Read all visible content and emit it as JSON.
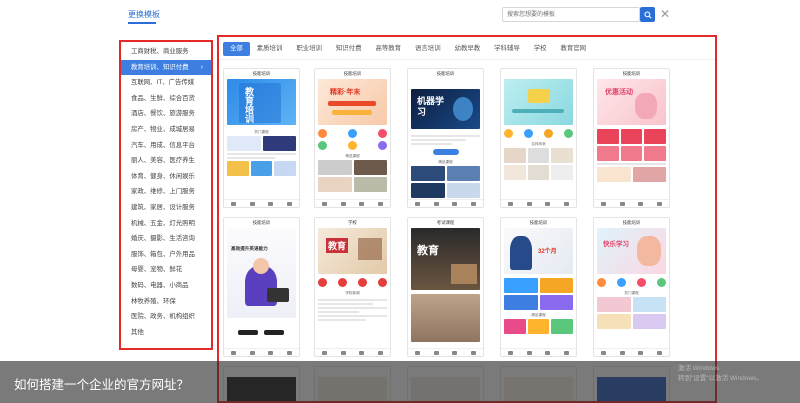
{
  "header": {
    "title": "更换模板",
    "search_placeholder": "搜索您想要的模板",
    "search_icon": "magnifier-icon",
    "close_icon": "close-x-icon",
    "accent_color": "#2b6fd6"
  },
  "sidebar": {
    "items": [
      {
        "label": "工商财税、商业服务"
      },
      {
        "label": "教育培训、知识付费",
        "active": true
      },
      {
        "label": "互联网、IT、广告传媒"
      },
      {
        "label": "食品、生鲜、综合百货"
      },
      {
        "label": "酒店、餐饮、旅游服务"
      },
      {
        "label": "房产、物业、成城居易"
      },
      {
        "label": "汽车、用成、信息平台"
      },
      {
        "label": "丽人、美容、医疗养生"
      },
      {
        "label": "体育、健身、休闲娱乐"
      },
      {
        "label": "家政、维修、上门服务"
      },
      {
        "label": "建筑、家居、设计服务"
      },
      {
        "label": "机械、五金、灯光照明"
      },
      {
        "label": "婚庆、摄影、生活咨询"
      },
      {
        "label": "服饰、箱包、户外用品"
      },
      {
        "label": "母婴、宠物、鲜花"
      },
      {
        "label": "数码、电器、小商品"
      },
      {
        "label": "林牧养殖、环保"
      },
      {
        "label": "医院、政务、机构组织"
      },
      {
        "label": "其他"
      }
    ]
  },
  "tabs": [
    {
      "label": "全部",
      "active": true
    },
    {
      "label": "素质培训"
    },
    {
      "label": "职业培训"
    },
    {
      "label": "知识付费"
    },
    {
      "label": "高等教育"
    },
    {
      "label": "语言培训"
    },
    {
      "label": "幼教早教"
    },
    {
      "label": "学科辅导"
    },
    {
      "label": "学校"
    },
    {
      "label": "教育官网"
    }
  ],
  "cards_row1": [
    {
      "head": "技能培训",
      "banner": "教育培训"
    },
    {
      "head": "技能培训",
      "banner": "精彩·年末"
    },
    {
      "head": "技能培训",
      "banner": "机器学习"
    },
    {
      "head": "",
      "banner": ""
    },
    {
      "head": "技能培训",
      "banner": "优惠活动"
    }
  ],
  "cards_row2": [
    {
      "head": "技能培训",
      "banner": "高效提升英语能力"
    },
    {
      "head": "学校",
      "banner": "教育"
    },
    {
      "head": "考试课程",
      "banner": "教育"
    },
    {
      "head": "技能培训",
      "banner": "32个月"
    },
    {
      "head": "技能培训",
      "banner": "快乐学习"
    }
  ],
  "caption": "如何搭建一个企业的官方网址？",
  "watermark": {
    "line1": "激活 Windows",
    "line2": "转到\"设置\"以激活 Windows。"
  }
}
